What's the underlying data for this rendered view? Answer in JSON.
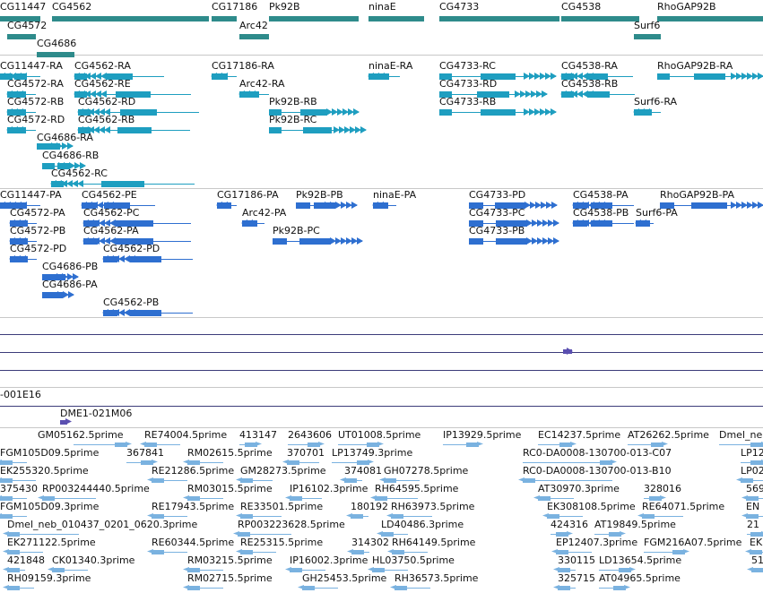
{
  "colors": {
    "gene": "#2e8b8b",
    "rna": "#1e9ec0",
    "protein": "#2e6fd0",
    "est": "#7ab2e0",
    "purple": "#5a4fb0",
    "separator": "#c8c8c8",
    "line_dark": "#3c3c7a"
  },
  "genes": [
    {
      "label": "CG11447"
    },
    {
      "label": "CG4562"
    },
    {
      "label": "CG17186"
    },
    {
      "label": "Pk92B"
    },
    {
      "label": "ninaE"
    },
    {
      "label": "CG4733"
    },
    {
      "label": "CG4538"
    },
    {
      "label": "RhoGAP92B"
    },
    {
      "label": "CG4572"
    },
    {
      "label": "Arc42"
    },
    {
      "label": "Surf6"
    },
    {
      "label": "CG4686"
    }
  ],
  "transcripts": [
    {
      "label": "CG11447-RA"
    },
    {
      "label": "CG4562-RA"
    },
    {
      "label": "CG17186-RA"
    },
    {
      "label": "ninaE-RA"
    },
    {
      "label": "CG4733-RC"
    },
    {
      "label": "CG4538-RA"
    },
    {
      "label": "RhoGAP92B-RA"
    },
    {
      "label": "CG4572-RA"
    },
    {
      "label": "CG4562-RE"
    },
    {
      "label": "Arc42-RA"
    },
    {
      "label": "CG4733-RD"
    },
    {
      "label": "CG4538-RB"
    },
    {
      "label": "CG4572-RB"
    },
    {
      "label": "CG4562-RD"
    },
    {
      "label": "Pk92B-RB"
    },
    {
      "label": "CG4733-RB"
    },
    {
      "label": "Surf6-RA"
    },
    {
      "label": "CG4572-RD"
    },
    {
      "label": "CG4562-RB"
    },
    {
      "label": "Pk92B-RC"
    },
    {
      "label": "CG4686-RA"
    },
    {
      "label": "CG4686-RB"
    },
    {
      "label": "CG4562-RC"
    }
  ],
  "proteins": [
    {
      "label": "CG11447-PA"
    },
    {
      "label": "CG4562-PE"
    },
    {
      "label": "CG17186-PA"
    },
    {
      "label": "Pk92B-PB"
    },
    {
      "label": "ninaE-PA"
    },
    {
      "label": "CG4733-PD"
    },
    {
      "label": "CG4538-PA"
    },
    {
      "label": "RhoGAP92B-PA"
    },
    {
      "label": "CG4572-PA"
    },
    {
      "label": "CG4562-PC"
    },
    {
      "label": "Arc42-PA"
    },
    {
      "label": "CG4733-PC"
    },
    {
      "label": "CG4538-PB"
    },
    {
      "label": "Surf6-PA"
    },
    {
      "label": "CG4572-PB"
    },
    {
      "label": "CG4562-PA"
    },
    {
      "label": "Pk92B-PC"
    },
    {
      "label": "CG4733-PB"
    },
    {
      "label": "CG4572-PD"
    },
    {
      "label": "CG4562-PD"
    },
    {
      "label": "CG4686-PB"
    },
    {
      "label": "CG4686-PA"
    },
    {
      "label": "CG4562-PB"
    }
  ],
  "clones": [
    {
      "label": "-001E16"
    },
    {
      "label": "DME1-021M06"
    }
  ],
  "ests": [
    {
      "label": "GM05162.5prime"
    },
    {
      "label": "RE74004.5prime"
    },
    {
      "label": "413147"
    },
    {
      "label": "2643606"
    },
    {
      "label": "UT01008.5prime"
    },
    {
      "label": "IP13929.5prime"
    },
    {
      "label": "EC14237.5prime"
    },
    {
      "label": "AT26262.5prime"
    },
    {
      "label": "Dmel_ne"
    },
    {
      "label": "FGM105D09.5prime"
    },
    {
      "label": "367841"
    },
    {
      "label": "RM02615.5prime"
    },
    {
      "label": "370701"
    },
    {
      "label": "LP13749.3prime"
    },
    {
      "label": "RC0-DA0008-130700-013-C07"
    },
    {
      "label": "LP12"
    },
    {
      "label": "EK255320.5prime"
    },
    {
      "label": "RE21286.5prime"
    },
    {
      "label": "GM28273.5prime"
    },
    {
      "label": "374081"
    },
    {
      "label": "GH07278.5prime"
    },
    {
      "label": "RC0-DA0008-130700-013-B10"
    },
    {
      "label": "LP02"
    },
    {
      "label": "375430"
    },
    {
      "label": "RP003244440.5prime"
    },
    {
      "label": "RM03015.5prime"
    },
    {
      "label": "IP16102.3prime"
    },
    {
      "label": "RH64595.5prime"
    },
    {
      "label": "AT30970.3prime"
    },
    {
      "label": "328016"
    },
    {
      "label": "569"
    },
    {
      "label": "FGM105D09.3prime"
    },
    {
      "label": "RE17943.5prime"
    },
    {
      "label": "RE33501.5prime"
    },
    {
      "label": "180192"
    },
    {
      "label": "RH63973.5prime"
    },
    {
      "label": "EK308108.5prime"
    },
    {
      "label": "RE64071.5prime"
    },
    {
      "label": "EN"
    },
    {
      "label": "Dmel_neb_010437_0201_0620.3prime"
    },
    {
      "label": "RP003223628.5prime"
    },
    {
      "label": "LD40486.3prime"
    },
    {
      "label": "424316"
    },
    {
      "label": "AT19849.5prime"
    },
    {
      "label": "21"
    },
    {
      "label": "EK271122.5prime"
    },
    {
      "label": "RE60344.5prime"
    },
    {
      "label": "RE25315.5prime"
    },
    {
      "label": "314302"
    },
    {
      "label": "RH64149.5prime"
    },
    {
      "label": "EP12407.3prime"
    },
    {
      "label": "FGM216A07.5prime"
    },
    {
      "label": "EK"
    },
    {
      "label": "421848"
    },
    {
      "label": "CK01340.3prime"
    },
    {
      "label": "RM03215.5prime"
    },
    {
      "label": "IP16002.3prime"
    },
    {
      "label": "HL03750.5prime"
    },
    {
      "label": "330115"
    },
    {
      "label": "LD13654.5prime"
    },
    {
      "label": "51"
    },
    {
      "label": "RH09159.3prime"
    },
    {
      "label": "RM02715.5prime"
    },
    {
      "label": "GH25453.5prime"
    },
    {
      "label": "RH36573.5prime"
    },
    {
      "label": "325715"
    },
    {
      "label": "AT04965.5prime"
    }
  ]
}
